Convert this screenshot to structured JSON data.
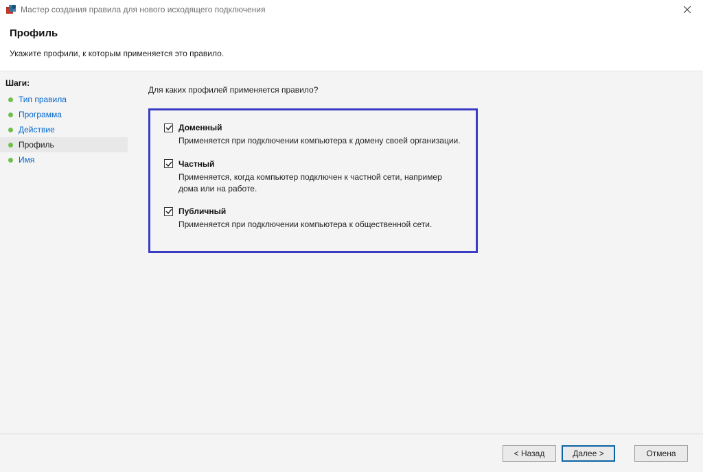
{
  "window": {
    "title": "Мастер создания правила для нового исходящего подключения"
  },
  "header": {
    "title": "Профиль",
    "description": "Укажите профили, к которым применяется это правило."
  },
  "sidebar": {
    "heading": "Шаги:",
    "steps": [
      {
        "label": "Тип правила",
        "active": false
      },
      {
        "label": "Программа",
        "active": false
      },
      {
        "label": "Действие",
        "active": false
      },
      {
        "label": "Профиль",
        "active": true
      },
      {
        "label": "Имя",
        "active": false
      }
    ]
  },
  "content": {
    "question": "Для каких профилей применяется правило?",
    "profiles": [
      {
        "label": "Доменный",
        "desc": "Применяется при подключении компьютера к домену своей организации.",
        "checked": true
      },
      {
        "label": "Частный",
        "desc": "Применяется, когда компьютер подключен к частной сети, например дома или на работе.",
        "checked": true
      },
      {
        "label": "Публичный",
        "desc": "Применяется при подключении компьютера к общественной сети.",
        "checked": true
      }
    ]
  },
  "buttons": {
    "back": "< Назад",
    "next": "Далее >",
    "cancel": "Отмена"
  }
}
